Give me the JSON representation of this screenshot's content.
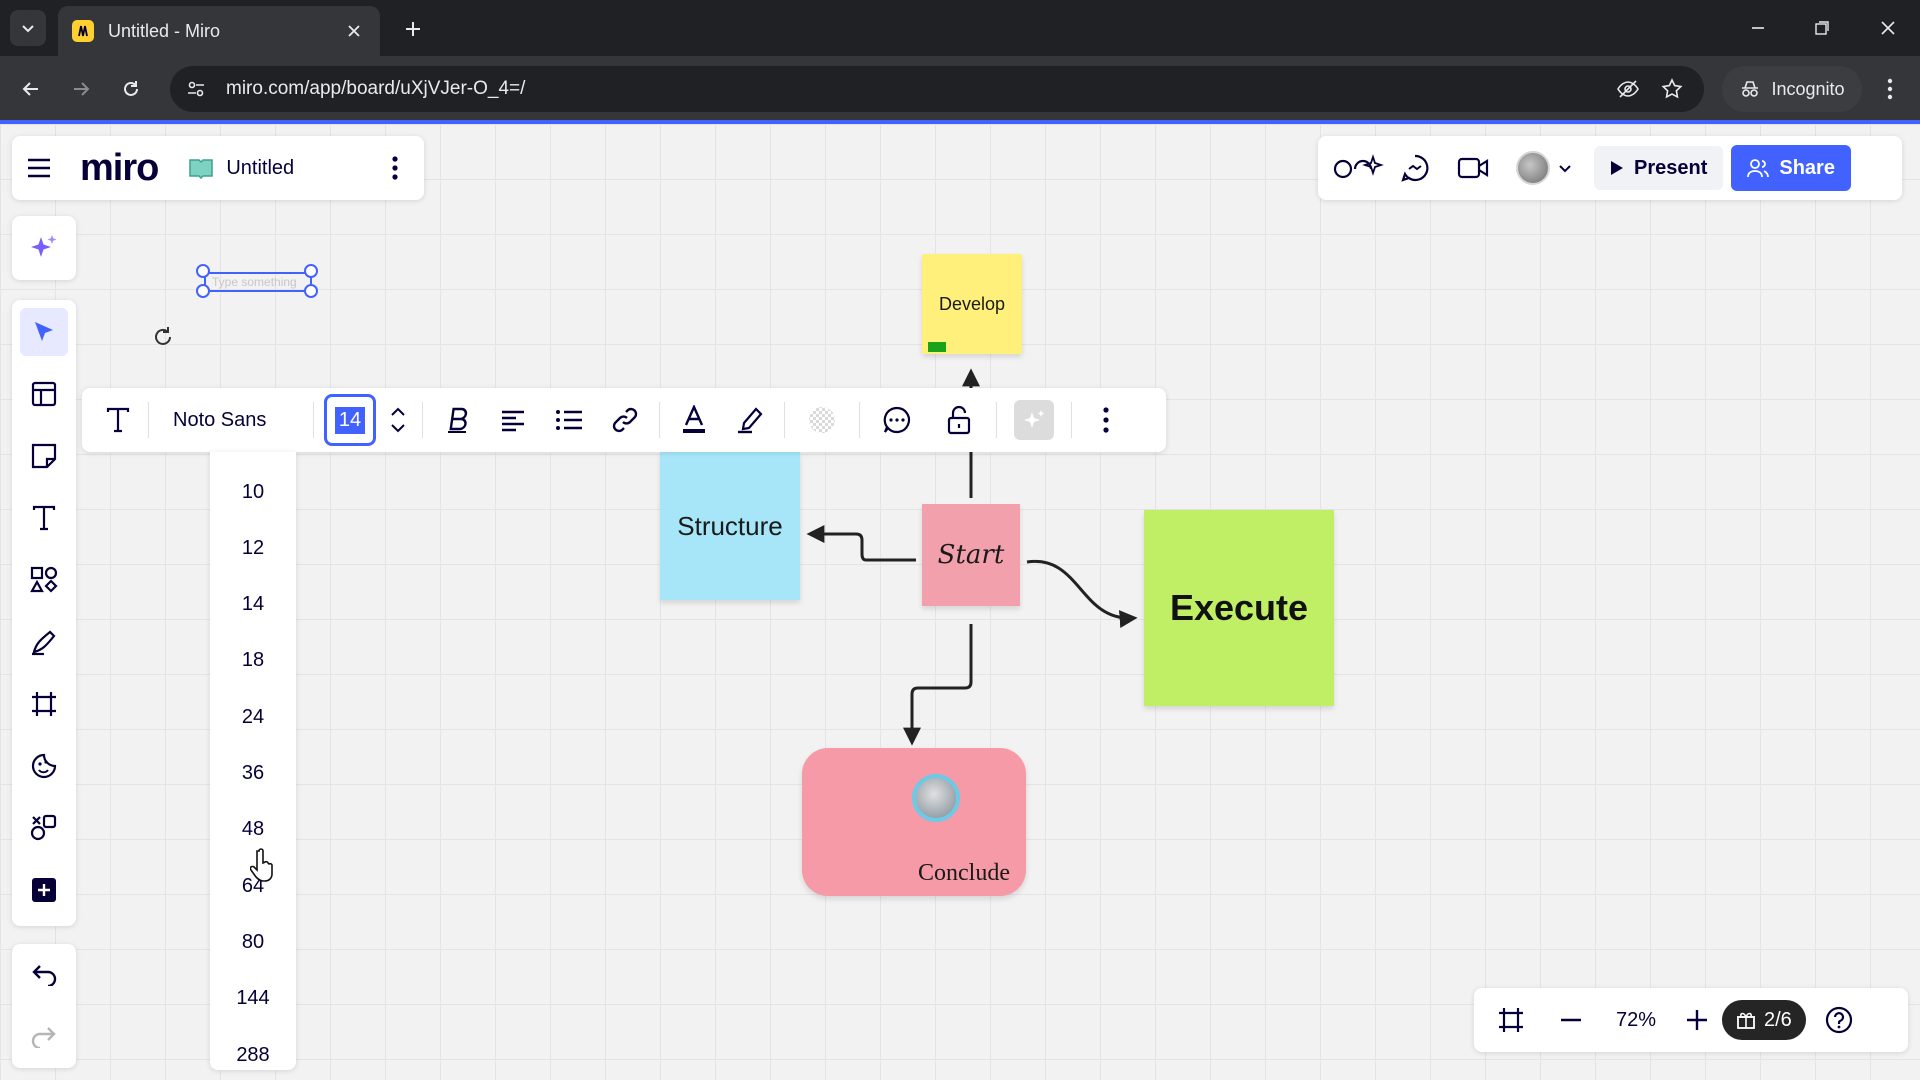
{
  "browser": {
    "tab_title": "Untitled - Miro",
    "url": "miro.com/app/board/uXjVJer-O_4=/",
    "incognito_label": "Incognito"
  },
  "app": {
    "logo_text": "miro",
    "board_title": "Untitled",
    "present_label": "Present",
    "share_label": "Share",
    "accent_color": "#4262ff"
  },
  "selected_text": {
    "placeholder": "Type something"
  },
  "format_toolbar": {
    "font_name": "Noto Sans",
    "font_size": "14"
  },
  "font_size_options": [
    "10",
    "12",
    "14",
    "18",
    "24",
    "36",
    "48",
    "64",
    "80",
    "144",
    "288"
  ],
  "stickies": {
    "develop": "Develop",
    "structure": "Structure",
    "start": "Start",
    "execute": "Execute",
    "conclude": "Conclude"
  },
  "bottom_bar": {
    "zoom": "72%",
    "pages": "2/6"
  },
  "icons": {
    "sidebar": [
      "ai-sparkle-icon",
      "select-cursor-icon",
      "templates-icon",
      "sticky-note-icon",
      "text-icon",
      "shapes-icon",
      "pen-icon",
      "frame-icon",
      "stickers-icon",
      "apps-icon",
      "add-icon"
    ]
  }
}
